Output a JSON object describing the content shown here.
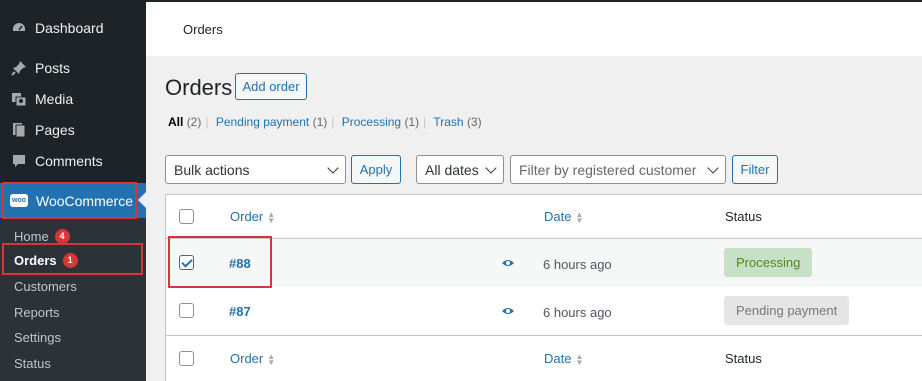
{
  "sidebar": {
    "items": [
      {
        "label": "Dashboard",
        "icon": "dashboard-icon"
      },
      {
        "label": "Posts",
        "icon": "pin-icon"
      },
      {
        "label": "Media",
        "icon": "media-icon"
      },
      {
        "label": "Pages",
        "icon": "pages-icon"
      },
      {
        "label": "Comments",
        "icon": "comment-icon"
      }
    ],
    "woocommerce": {
      "label": "WooCommerce",
      "logo_text": "woo"
    },
    "submenu": [
      {
        "label": "Home",
        "count": "4"
      },
      {
        "label": "Orders",
        "count": "1"
      },
      {
        "label": "Customers"
      },
      {
        "label": "Reports"
      },
      {
        "label": "Settings"
      },
      {
        "label": "Status"
      }
    ]
  },
  "header": {
    "title": "Orders"
  },
  "page": {
    "title": "Orders",
    "add_button": "Add order"
  },
  "filters_links": {
    "all": "All",
    "all_count": "(2)",
    "pending": "Pending payment",
    "pending_count": "(1)",
    "processing": "Processing",
    "processing_count": "(1)",
    "trash": "Trash",
    "trash_count": "(3)"
  },
  "toolbar": {
    "bulk_actions": "Bulk actions",
    "apply": "Apply",
    "dates": "All dates",
    "customer_placeholder": "Filter by registered customer",
    "filter": "Filter"
  },
  "table": {
    "columns": {
      "order": "Order",
      "date": "Date",
      "status": "Status"
    },
    "rows": [
      {
        "order": "#88",
        "date": "6 hours ago",
        "status": "Processing",
        "checked": true
      },
      {
        "order": "#87",
        "date": "6 hours ago",
        "status": "Pending payment",
        "checked": false
      }
    ]
  },
  "colors": {
    "sidebar_bg": "#1d2327",
    "accent": "#2271b1",
    "highlight_box": "#d63638",
    "processing_bg": "#c6e1c6",
    "pending_bg": "#e5e5e5"
  }
}
